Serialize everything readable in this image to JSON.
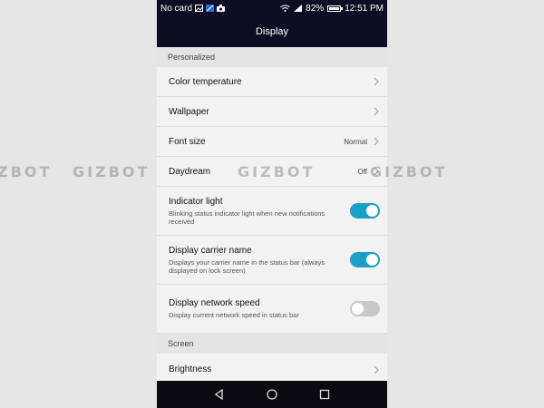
{
  "status_bar": {
    "carrier": "No card",
    "battery": "82%",
    "battery_level": 0.82,
    "time": "12:51 PM"
  },
  "header": {
    "title": "Display"
  },
  "sections": [
    {
      "title": "Personalized"
    },
    {
      "title": "Screen"
    }
  ],
  "settings": {
    "color_temperature": {
      "label": "Color temperature"
    },
    "wallpaper": {
      "label": "Wallpaper"
    },
    "font_size": {
      "label": "Font size",
      "value": "Normal"
    },
    "daydream": {
      "label": "Daydream",
      "value": "Off"
    },
    "indicator_light": {
      "label": "Indicator light",
      "description": "Blinking status indicator light when new notifications received",
      "enabled": true
    },
    "display_carrier_name": {
      "label": "Display carrier name",
      "description": "Displays your carrier name in the status bar (always displayed on lock screen)",
      "enabled": true
    },
    "display_network_speed": {
      "label": "Display network speed",
      "description": "Display current network speed in status bar",
      "enabled": false
    },
    "brightness": {
      "label": "Brightness"
    }
  },
  "watermark": [
    "GIZBOT",
    "GIZBOT",
    "GIZBOT",
    "GIZBOT"
  ],
  "colors": {
    "toggle_on": "#1a9fc6",
    "toggle_off": "#c8c8c8",
    "header_bg": "#0e0d24",
    "navbar_bg": "#0b0b0f"
  },
  "icons": {
    "nav": [
      "back-icon",
      "home-icon",
      "recents-icon"
    ],
    "status": [
      "image-icon",
      "app-icon",
      "camera-icon",
      "wifi-icon",
      "signal-icon",
      "battery-icon"
    ]
  }
}
